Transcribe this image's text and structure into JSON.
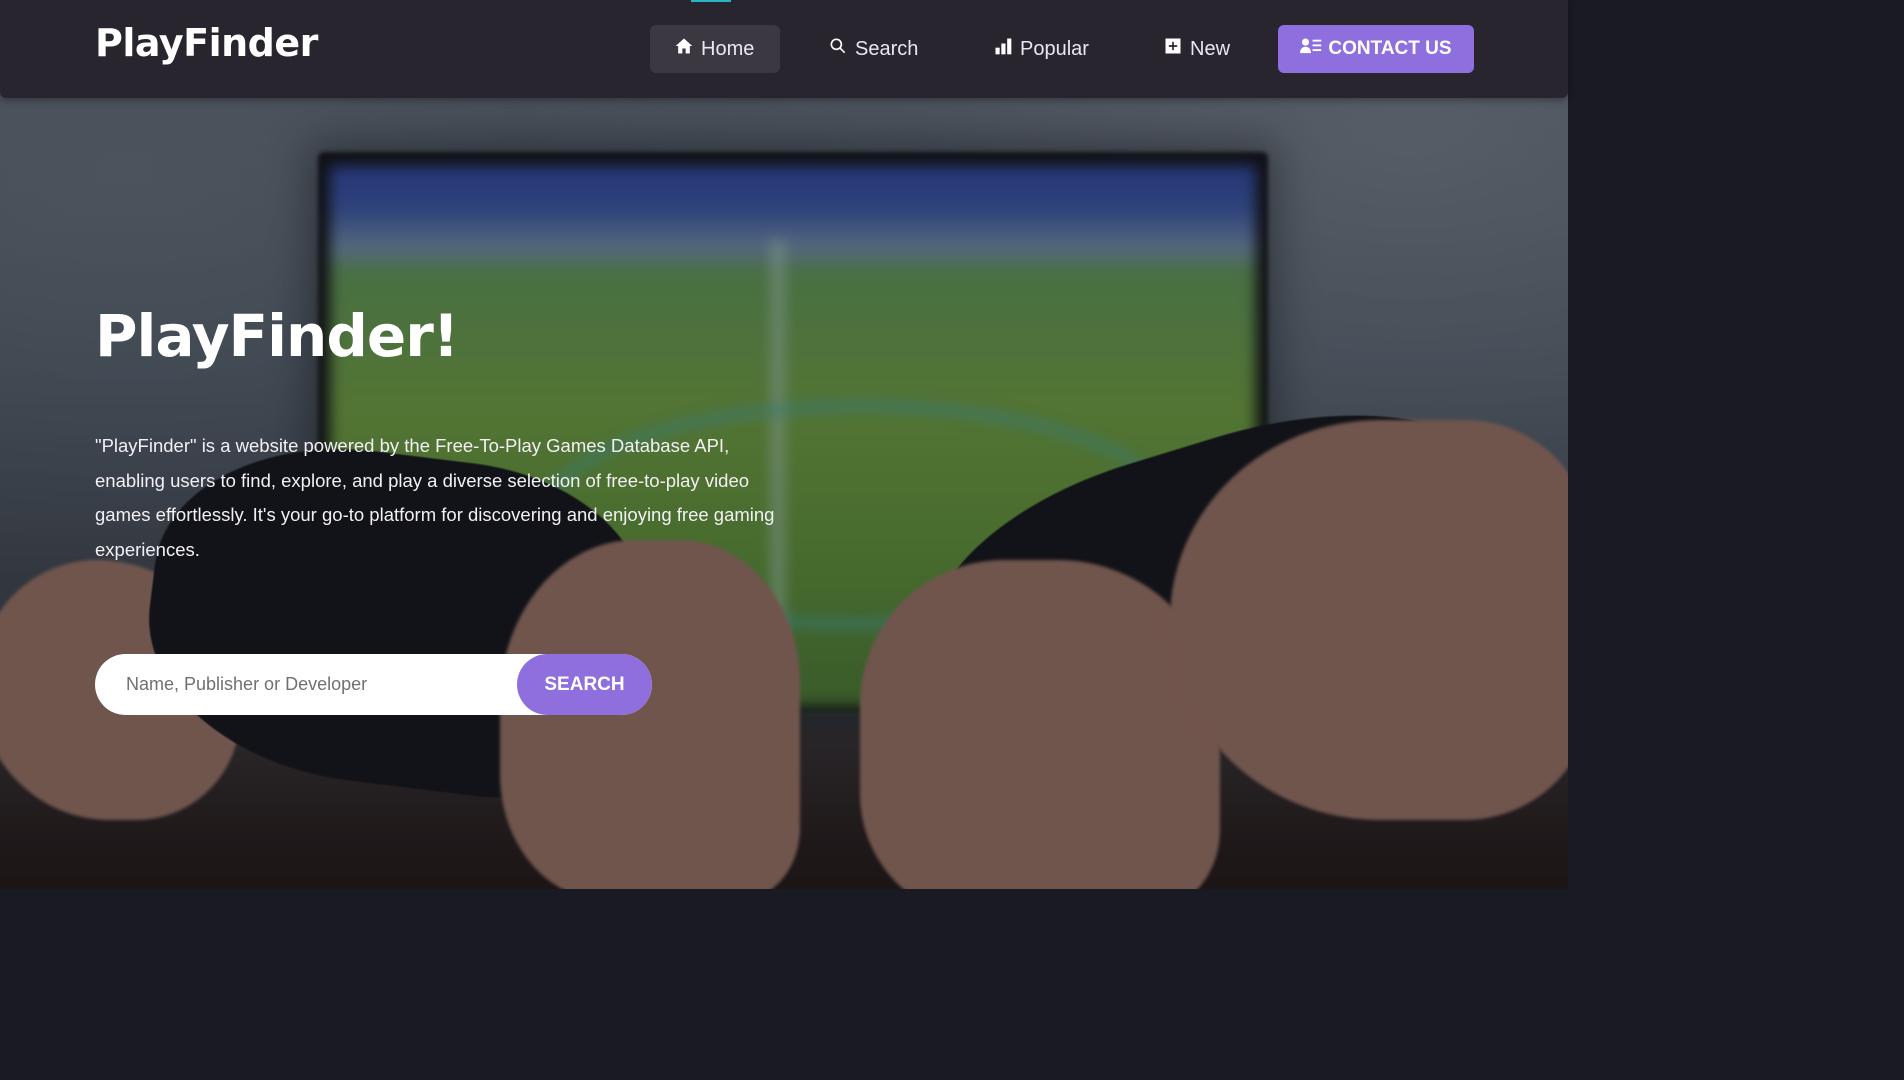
{
  "navbar": {
    "brand": "PlayFinder",
    "items": [
      {
        "label": "Home",
        "icon": "home-icon",
        "active": true
      },
      {
        "label": "Search",
        "icon": "search-icon",
        "active": false
      },
      {
        "label": "Popular",
        "icon": "bar-chart-icon",
        "active": false
      },
      {
        "label": "New",
        "icon": "plus-square-icon",
        "active": false
      }
    ],
    "contact_label": "CONTACT US",
    "contact_icon": "contact-card-icon"
  },
  "hero": {
    "title": "PlayFinder!",
    "description": "\"PlayFinder\" is a website powered by the Free-To-Play Games Database API, enabling users to find, explore, and play a diverse selection of free-to-play video games effortlessly. It's your go-to platform for discovering and enjoying free gaming experiences.",
    "background_image": "hands-holding-game-controllers-in-front-of-tv"
  },
  "search": {
    "placeholder": "Name, Publisher or Developer",
    "value": "",
    "button_label": "SEARCH"
  },
  "colors": {
    "accent": "#8f6fde",
    "navbar_bg": "#28252f",
    "active_item_bg": "#3b3842"
  }
}
